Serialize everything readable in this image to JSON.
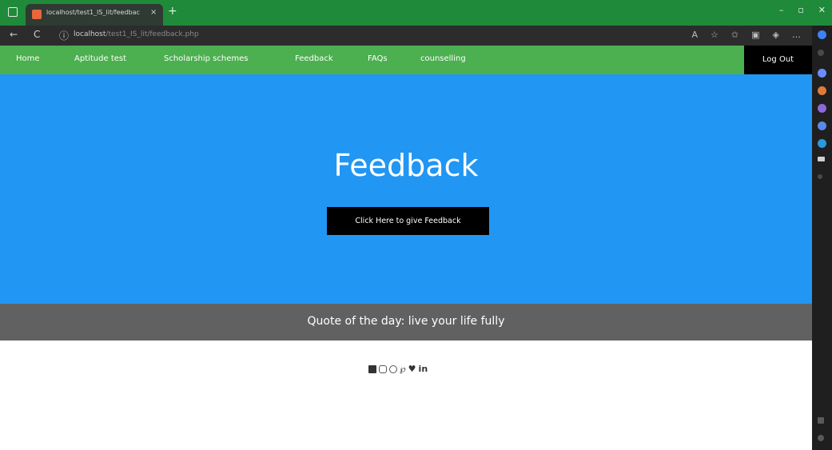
{
  "browser": {
    "tab_title": "localhost/test1_IS_lit/feedbac",
    "tab_close": "×",
    "new_tab": "+",
    "controls": [
      "–",
      "▫",
      "✕"
    ],
    "url_host": "localhost",
    "url_path": "/test1_IS_lit/feedback.php",
    "nav_back": "←",
    "nav_reload": "C",
    "nav_info": "ⓘ"
  },
  "site_nav": {
    "items": [
      "Home",
      "Aptitude test",
      "Scholarship schemes",
      "Feedback",
      "FAQs",
      "counselling"
    ],
    "logout": "Log Out"
  },
  "hero": {
    "title": "Feedback",
    "button": "Click Here to give Feedback"
  },
  "quote": {
    "text": "Quote of the day: live your life fully"
  },
  "social": {
    "icons": [
      "facebook-icon",
      "instagram-icon",
      "github-icon",
      "pinterest-icon",
      "twitter-icon",
      "linkedin-icon"
    ],
    "twitter_glyph": "♥",
    "linkedin_text": "in",
    "pinterest_glyph": "℘"
  },
  "colors": {
    "browser_chrome": "#1f8a3a",
    "nav_green": "#4caf50",
    "hero_blue": "#2196f3",
    "quote_gray": "#616161",
    "button_black": "#000000"
  }
}
